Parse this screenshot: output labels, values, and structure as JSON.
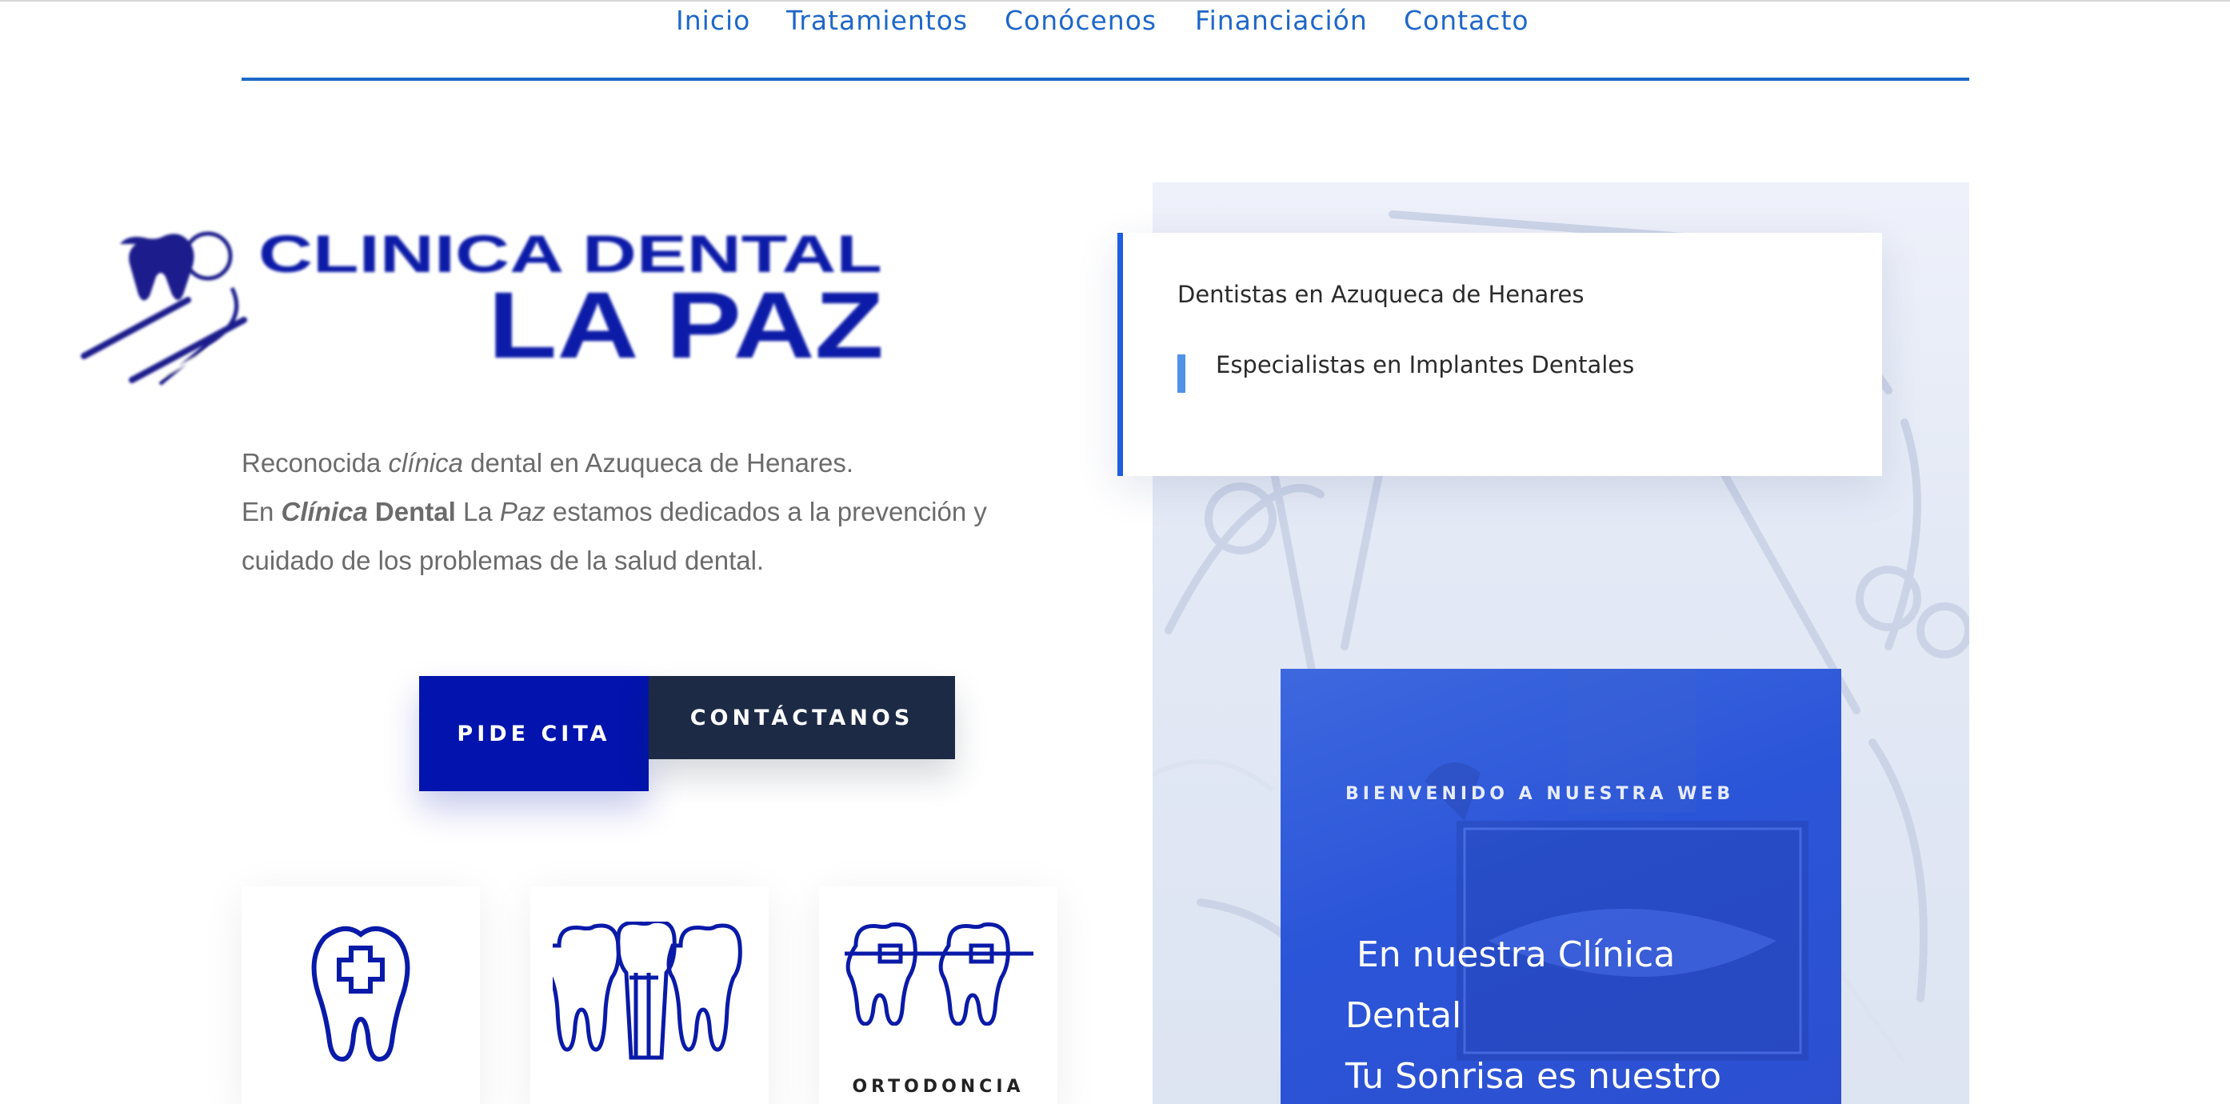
{
  "nav": {
    "items": [
      {
        "label": "Inicio"
      },
      {
        "label": "Tratamientos"
      },
      {
        "label": "Conócenos"
      },
      {
        "label": "Financiación"
      },
      {
        "label": "Contacto"
      }
    ]
  },
  "logo": {
    "line1": "CLINICA DENTAL",
    "line2": "LA PAZ"
  },
  "intro": {
    "p1_a": "Reconocida ",
    "p1_b": "clínica",
    "p1_c": " dental en Azuqueca de Henares.",
    "p2_a": "En ",
    "p2_b": "Clínica",
    "p2_c": " Dental",
    "p2_d": " La ",
    "p2_e": "Paz",
    "p2_f": " estamos dedicados a la prevención y cuidado de los problemas de la salud dental."
  },
  "buttons": {
    "cita": "PIDE CITA",
    "contact": "CONTÁCTANOS"
  },
  "services": [
    {
      "icon": "tooth-cross-icon",
      "label": ""
    },
    {
      "icon": "teeth-implant-icon",
      "label": ""
    },
    {
      "icon": "braces-icon",
      "label": "ORTODONCIA"
    }
  ],
  "info": {
    "heading": "Dentistas en Azuqueca de Henares",
    "sub": "Especialistas en Implantes Dentales"
  },
  "welcome": {
    "eyebrow": "BIENVENIDO A NUESTRA WEB",
    "title_line1": " En nuestra Clínica",
    "title_line2": "Dental",
    "title_line3": "Tu Sonrisa es nuestro"
  },
  "colors": {
    "nav": "#1e67c8",
    "brand_blue": "#0214ad",
    "dark_navy": "#1c2a45",
    "accent": "#1e5ee0",
    "welcome_bg": "#2b55d8"
  }
}
